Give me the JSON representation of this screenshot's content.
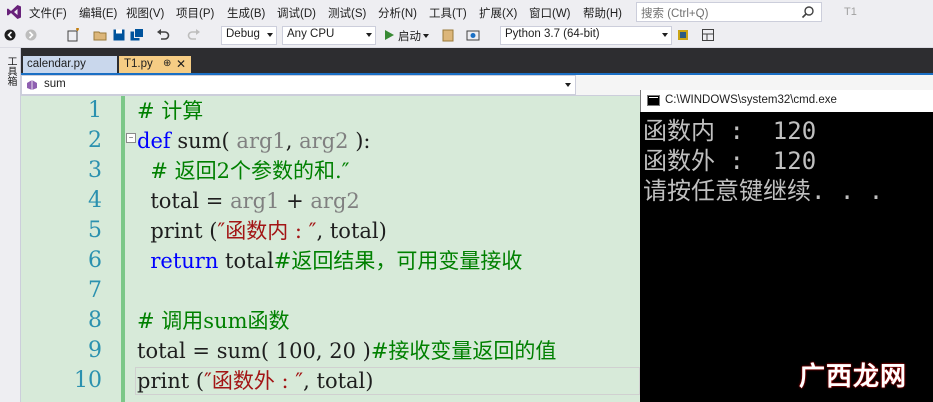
{
  "menu": {
    "items": [
      "文件(F)",
      "编辑(E)",
      "视图(V)",
      "项目(P)",
      "生成(B)",
      "调试(D)",
      "测试(S)",
      "分析(N)",
      "工具(T)",
      "扩展(X)",
      "窗口(W)",
      "帮助(H)"
    ],
    "search_placeholder": "搜索 (Ctrl+Q)",
    "window_badge": "T1"
  },
  "toolbar": {
    "config": "Debug",
    "platform": "Any CPU",
    "start_label": "启动",
    "environment": "Python 3.7 (64-bit)"
  },
  "left_strip": {
    "label": "工具箱"
  },
  "tabs": [
    {
      "label": "calendar.py",
      "active": false
    },
    {
      "label": "T1.py",
      "active": true,
      "pin": "⊕",
      "close": "✕"
    }
  ],
  "nav": {
    "scope": "sum"
  },
  "editor": {
    "line_numbers": [
      "1",
      "2",
      "3",
      "4",
      "5",
      "6",
      "7",
      "8",
      "9",
      "10"
    ],
    "lines": [
      {
        "parts": [
          {
            "t": "# 计算",
            "c": "cmt"
          }
        ]
      },
      {
        "parts": [
          {
            "t": "def",
            "c": "kw"
          },
          {
            "t": " sum( ",
            "c": ""
          },
          {
            "t": "arg1",
            "c": "prm"
          },
          {
            "t": ", ",
            "c": ""
          },
          {
            "t": "arg2",
            "c": "prm"
          },
          {
            "t": " ):",
            "c": ""
          }
        ]
      },
      {
        "parts": [
          {
            "t": "  # 返回2个参数的和.″",
            "c": "cmt"
          }
        ]
      },
      {
        "parts": [
          {
            "t": "  total = ",
            "c": ""
          },
          {
            "t": "arg1",
            "c": "prm"
          },
          {
            "t": " + ",
            "c": ""
          },
          {
            "t": "arg2",
            "c": "prm"
          }
        ]
      },
      {
        "parts": [
          {
            "t": "  print (",
            "c": ""
          },
          {
            "t": "″函数内 : ″",
            "c": "str"
          },
          {
            "t": ", total)",
            "c": ""
          }
        ]
      },
      {
        "parts": [
          {
            "t": "  ",
            "c": ""
          },
          {
            "t": "return",
            "c": "kw"
          },
          {
            "t": " total",
            "c": ""
          },
          {
            "t": "#返回结果，可用变量接收",
            "c": "cmt"
          }
        ]
      },
      {
        "parts": [
          {
            "t": "",
            "c": ""
          }
        ]
      },
      {
        "parts": [
          {
            "t": "# 调用sum函数",
            "c": "cmt"
          }
        ]
      },
      {
        "parts": [
          {
            "t": "total = sum( 100, 20 )",
            "c": ""
          },
          {
            "t": "#接收变量返回的值",
            "c": "cmt"
          }
        ]
      },
      {
        "parts": [
          {
            "t": "print (",
            "c": ""
          },
          {
            "t": "″函数外 : ″",
            "c": "str"
          },
          {
            "t": ", total)",
            "c": ""
          }
        ]
      }
    ]
  },
  "console": {
    "title": "C:\\WINDOWS\\system32\\cmd.exe",
    "lines": [
      "函数内 :  120",
      "函数外 :  120",
      "请按任意键继续. . ."
    ]
  },
  "watermark": "广西龙网",
  "colors": {
    "accent": "#1a6fc4",
    "active_tab": "#f5cc84",
    "editor_bg": "#d7ead9",
    "line_number": "#2b91af",
    "keyword": "#0000ff",
    "comment": "#008000",
    "string": "#a31515"
  }
}
